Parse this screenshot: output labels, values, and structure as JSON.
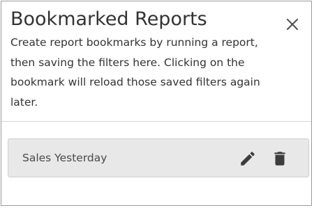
{
  "dialog": {
    "title": "Bookmarked Reports",
    "description": "Create report bookmarks by running a report, then saving the filters here. Clicking on the bookmark will reload those saved filters again later.",
    "close_icon": "close-icon"
  },
  "bookmarks": [
    {
      "label": "Sales Yesterday",
      "edit_icon": "pencil-icon",
      "delete_icon": "trash-icon"
    }
  ],
  "colors": {
    "row_background": "#e8e8e8",
    "text": "#333333",
    "icon": "#3c3c3c",
    "border": "#9a9a9a"
  }
}
